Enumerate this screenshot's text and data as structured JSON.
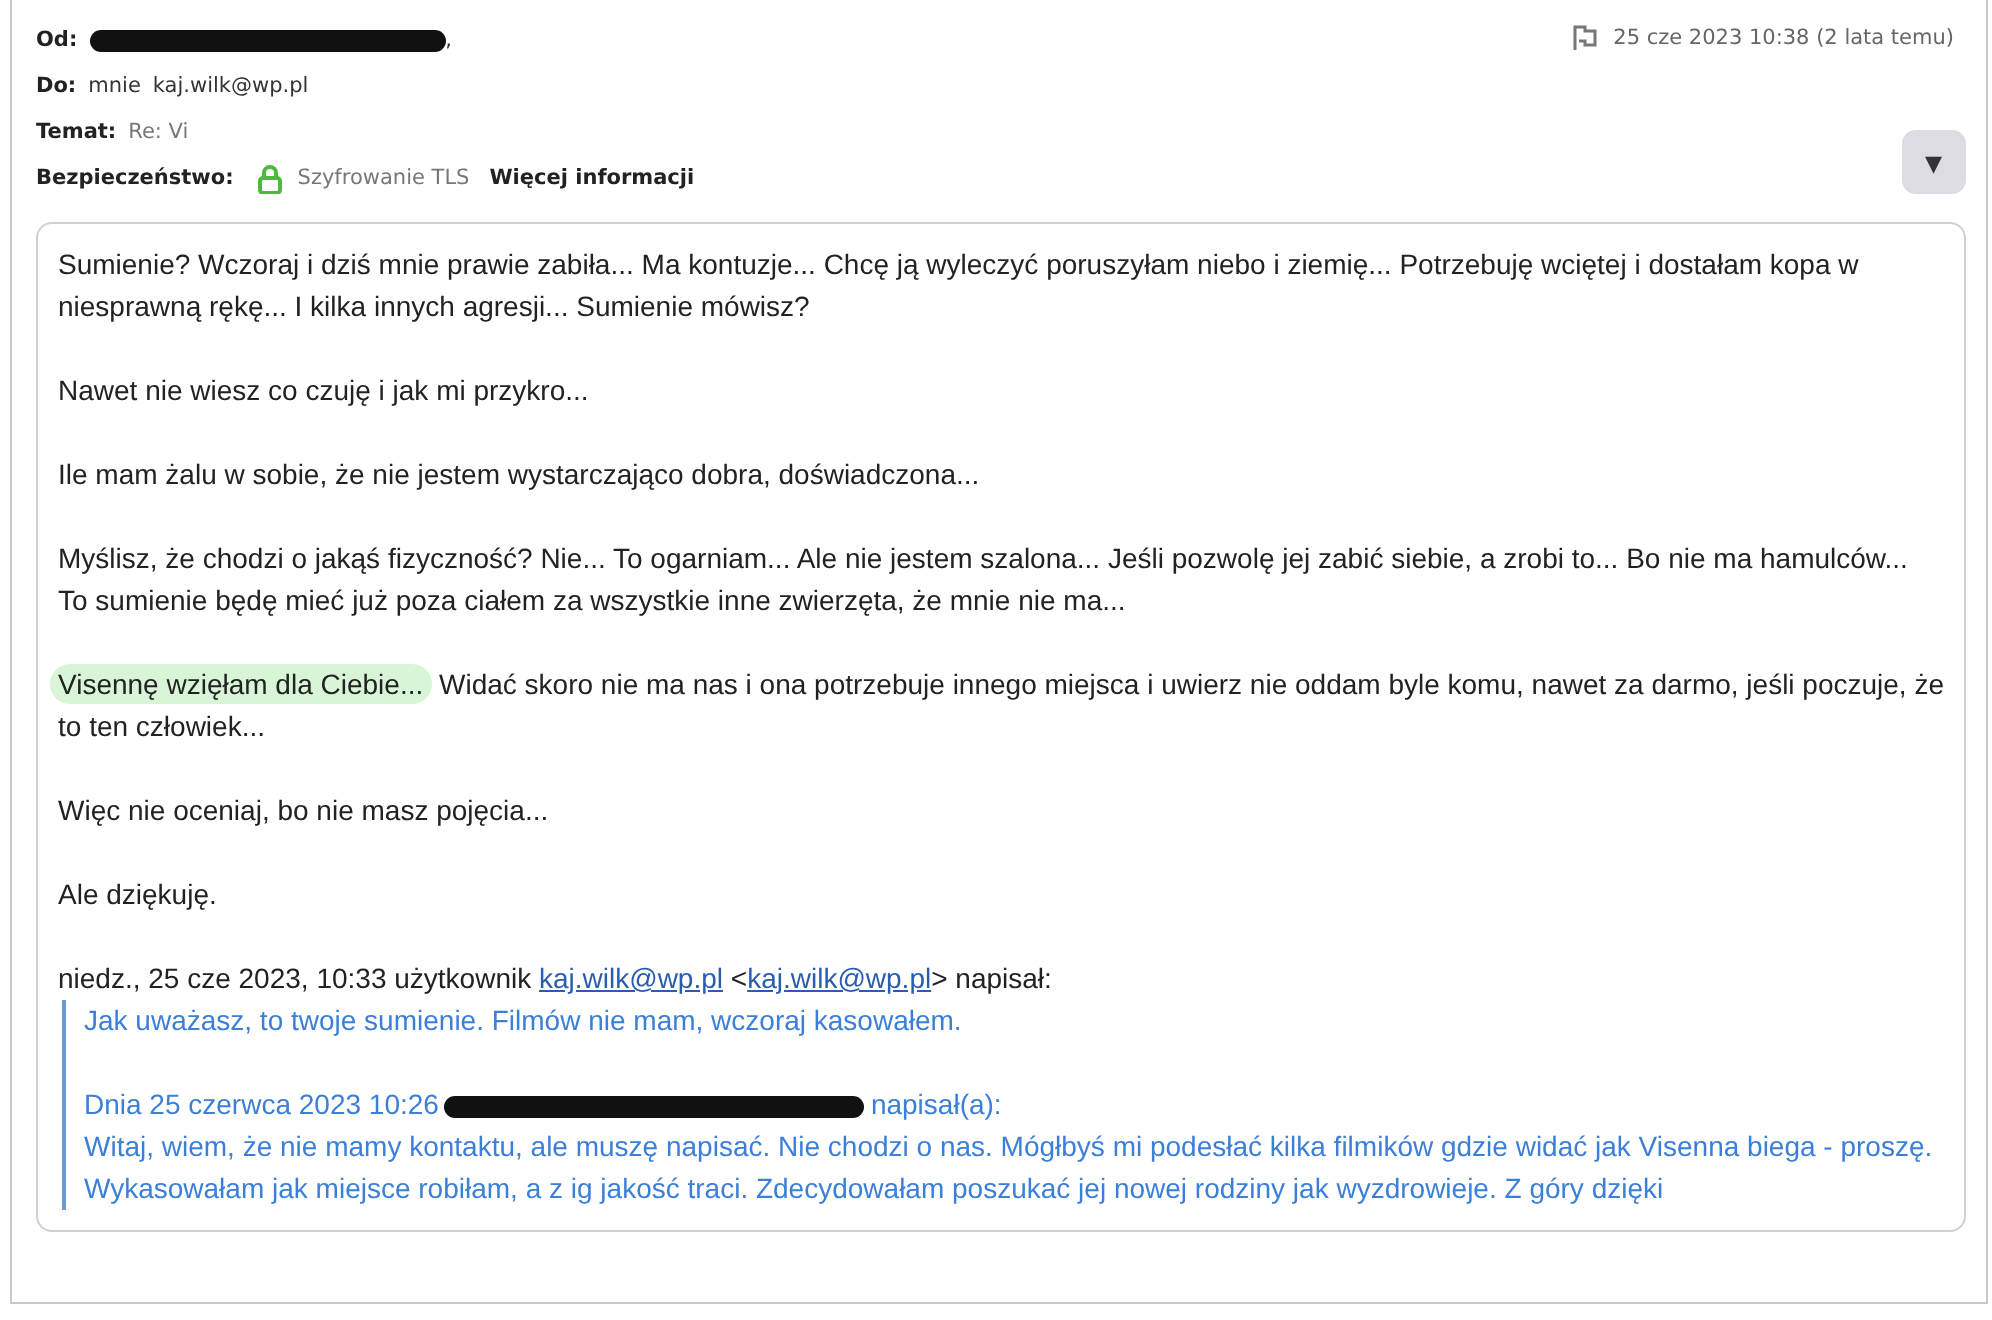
{
  "header": {
    "from_label": "Od:",
    "from_suffix": ",",
    "to_label": "Do:",
    "to_name": "mnie",
    "to_address": "kaj.wilk@wp.pl",
    "subject_label": "Temat:",
    "subject": "Re: Vi",
    "security_label": "Bezpieczeństwo:",
    "security_value": "Szyfrowanie TLS",
    "more_info": "Więcej informacji",
    "date": "25 cze 2023 10:38 (2 lata temu)",
    "expand_button": "▾"
  },
  "body": [
    {
      "text": "Sumienie? Wczoraj i dziś mnie prawie zabiła... Ma kontuzje... Chcę ją wyleczyć poruszyłam niebo i ziemię... Potrzebuję wciętej i dostałam kopa w niesprawną rękę... I kilka innych agresji... Sumienie mówisz?"
    },
    {
      "text": "Nawet nie wiesz co czuję i jak mi przykro..."
    },
    {
      "text": "Ile mam żalu w sobie, że nie jestem wystarczająco dobra, doświadczona..."
    },
    {
      "text": "Myślisz, że chodzi o jakąś fizyczność? Nie... To ogarniam... Ale nie jestem szalona... Jeśli pozwolę jej zabić siebie, a zrobi to... Bo nie ma hamulców... To sumienie będę mieć już poza ciałem za wszystkie inne zwierzęta, że mnie nie ma..."
    },
    {
      "highlight": "Visennę wzięłam dla Ciebie...",
      "text": " Widać skoro nie ma nas i ona potrzebuje innego miejsca i uwierz nie oddam byle komu, nawet za darmo, jeśli poczuje, że to ten człowiek..."
    },
    {
      "text": "Więc nie oceniaj, bo nie masz pojęcia..."
    },
    {
      "text": "Ale dziękuję."
    }
  ],
  "attribution": [
    {
      "kind": "text",
      "text": "niedz., 25 cze 2023, 10:33 użytkownik "
    },
    {
      "kind": "link",
      "text": "kaj.wilk@wp.pl"
    },
    {
      "kind": "text",
      "text": " <"
    },
    {
      "kind": "link",
      "text": "kaj.wilk@wp.pl"
    },
    {
      "kind": "text",
      "text": "> napisał:"
    }
  ],
  "quote": {
    "reply": "Jak uważasz, to twoje sumienie. Filmów nie mam, wczoraj kasowałem.",
    "inner_attribution_start": "Dnia 25 czerwca 2023 10:26",
    "inner_attribution_end": "napisał(a):",
    "inner_text": "Witaj, wiem, że nie mamy kontaktu, ale muszę napisać. Nie chodzi o nas. Mógłbyś mi podesłać kilka filmików gdzie widać jak Visenna biega - proszę. Wykasowałam jak miejsce robiłam, a z ig jakość traci. Zdecydowałam poszukać jej nowej rodziny jak wyzdrowieje. Z góry dzięki"
  }
}
